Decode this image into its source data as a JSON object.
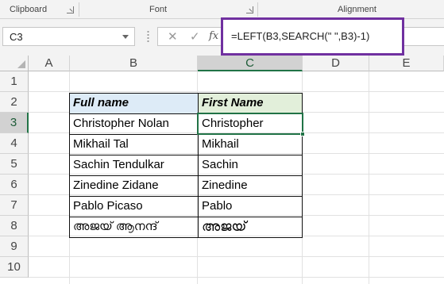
{
  "ribbon": {
    "groups": [
      "Clipboard",
      "Font",
      "Alignment"
    ]
  },
  "formula_bar": {
    "name_box": "C3",
    "cancel_icon": "✕",
    "enter_icon": "✓",
    "fx_label": "fx",
    "formula": "=LEFT(B3,SEARCH(\" \",B3)-1)",
    "highlight_color": "#7030a0"
  },
  "columns": [
    "A",
    "B",
    "C",
    "D",
    "E"
  ],
  "rows": [
    "1",
    "2",
    "3",
    "4",
    "5",
    "6",
    "7",
    "8",
    "9",
    "10"
  ],
  "selected": {
    "column": "C",
    "row": "3"
  },
  "table": {
    "headers": [
      "Full name",
      "First Name"
    ],
    "header_fills": [
      "#ddebf7",
      "#e2efda"
    ],
    "data": [
      [
        "Christopher Nolan",
        "Christopher"
      ],
      [
        "Mikhail Tal",
        "Mikhail"
      ],
      [
        "Sachin Tendulkar",
        "Sachin"
      ],
      [
        "Zinedine Zidane",
        "Zinedine"
      ],
      [
        "Pablo Picaso",
        "Pablo"
      ],
      [
        "അജയ് ആനന്ദ്",
        "അജയ്"
      ]
    ]
  },
  "colors": {
    "selection": "#217346"
  }
}
